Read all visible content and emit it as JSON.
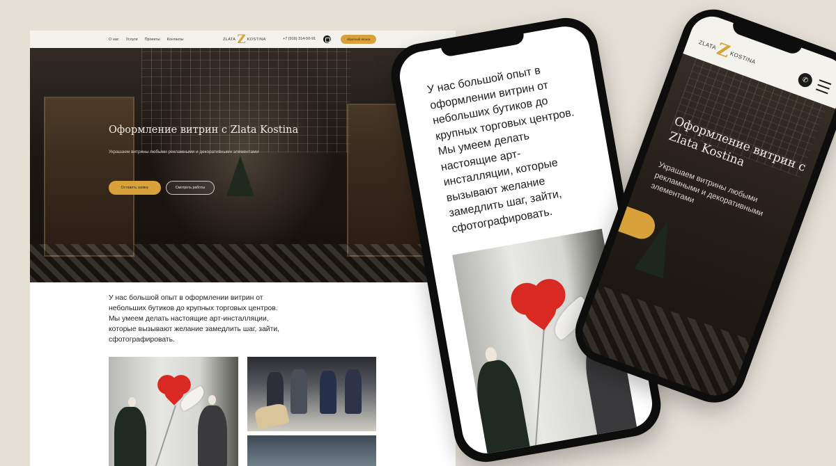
{
  "desktop": {
    "nav": {
      "links": [
        "О нас",
        "Услуги",
        "Проекты",
        "Контакты"
      ],
      "logo_left": "ZLATA",
      "logo_mark": "Z",
      "logo_right": "KOSTINA",
      "phone": "+7 (916) 314-50-91",
      "cta": "обратный звонок"
    },
    "hero": {
      "title": "Оформление витрин с Zlata Kostina",
      "subtitle": "Украшаем витрины любыми рекламными и декоративными элементами",
      "button_primary": "Оставить заявку",
      "button_secondary": "Смотреть работы"
    },
    "intro": "У нас большой опыт в оформлении витрин от небольших бутиков до крупных торговых центров. Мы умеем делать настоящие арт-инсталляции, которые вызывают желание замедлить шаг, зайти, сфотографировать."
  },
  "phone_a": {
    "text": "У нас большой опыт в оформлении витрин от небольших бутиков до крупных торговых центров. Мы умеем делать настоящие арт-инсталляции, которые вызывают желание замедлить шаг, зайти, сфотографировать."
  },
  "phone_b": {
    "logo_left": "ZLATA",
    "logo_mark": "Z",
    "logo_right": "KOSTINA",
    "title": "Оформление витрин с Zlata Kostina",
    "subtitle": "Украшаем витрины любыми рекламными и декоративными элементами"
  },
  "colors": {
    "background": "#e5e0d6",
    "accent": "#d8a13a",
    "nav_bg": "#f4f2ec",
    "phone_frame": "#0d0d0d"
  },
  "icons": [
    "instagram-icon",
    "phone-call-icon",
    "hamburger-menu-icon"
  ]
}
